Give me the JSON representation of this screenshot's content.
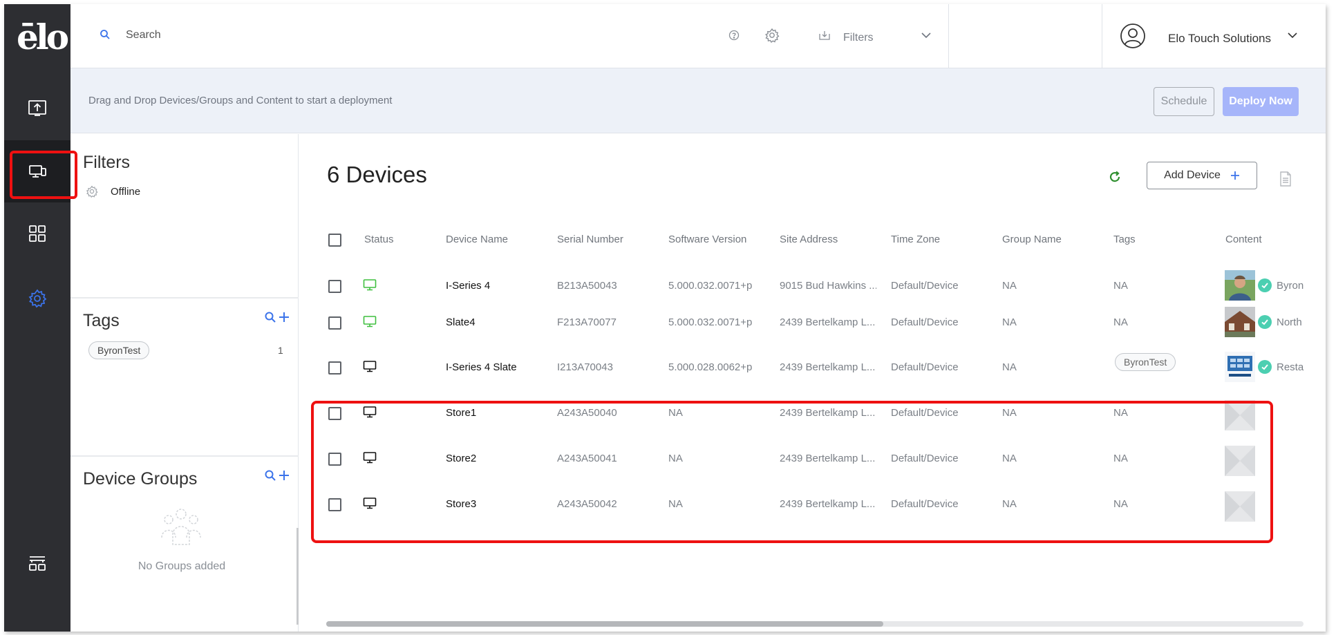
{
  "app": {
    "logo_text": "ēlo"
  },
  "topbar": {
    "search_placeholder": "Search",
    "filters_label": "Filters",
    "user_name": "Elo Touch Solutions"
  },
  "deploy": {
    "message": "Drag and Drop Devices/Groups and Content to start a deployment",
    "schedule_label": "Schedule",
    "deploy_label": "Deploy Now"
  },
  "filters": {
    "title": "Filters",
    "items": [
      {
        "label": "Offline"
      }
    ]
  },
  "tags": {
    "title": "Tags",
    "items": [
      {
        "label": "ByronTest",
        "count": "1"
      }
    ]
  },
  "groups": {
    "title": "Device Groups",
    "empty_text": "No Groups added"
  },
  "devices": {
    "title": "6 Devices",
    "add_label": "Add Device",
    "columns": [
      "Status",
      "Device Name",
      "Serial Number",
      "Software Version",
      "Site Address",
      "Time Zone",
      "Group Name",
      "Tags",
      "Content"
    ],
    "rows": [
      {
        "status": "online",
        "name": "I-Series 4",
        "serial": "B213A50043",
        "version": "5.000.032.0071+p",
        "address": "9015 Bud Hawkins ...",
        "timezone": "Default/Device",
        "group": "NA",
        "tags": "NA",
        "content": "Byron"
      },
      {
        "status": "online",
        "name": "Slate4",
        "serial": "F213A70077",
        "version": "5.000.032.0071+p",
        "address": "2439 Bertelkamp L...",
        "timezone": "Default/Device",
        "group": "NA",
        "tags": "NA",
        "content": "North"
      },
      {
        "status": "offline",
        "name": "I-Series 4 Slate",
        "serial": "I213A70043",
        "version": "5.000.028.0062+p",
        "address": "2439 Bertelkamp L...",
        "timezone": "Default/Device",
        "group": "NA",
        "tags": "ByronTest",
        "content": "Restau"
      },
      {
        "status": "offline",
        "name": "Store1",
        "serial": "A243A50040",
        "version": "NA",
        "address": "2439 Bertelkamp L...",
        "timezone": "Default/Device",
        "group": "NA",
        "tags": "NA",
        "content": ""
      },
      {
        "status": "offline",
        "name": "Store2",
        "serial": "A243A50041",
        "version": "NA",
        "address": "2439 Bertelkamp L...",
        "timezone": "Default/Device",
        "group": "NA",
        "tags": "NA",
        "content": ""
      },
      {
        "status": "offline",
        "name": "Store3",
        "serial": "A243A50042",
        "version": "NA",
        "address": "2439 Bertelkamp L...",
        "timezone": "Default/Device",
        "group": "NA",
        "tags": "NA",
        "content": ""
      }
    ]
  },
  "colors": {
    "rail": "#2d2e32",
    "accent_blue": "#3b73ea",
    "online_green": "#3fbf3f",
    "highlight_red": "#ee1111",
    "deploy_button": "#a6b5fa",
    "refresh_green": "#2f8f2f"
  },
  "icons": [
    "search-icon",
    "help-icon",
    "gear-icon",
    "filter-download-icon",
    "chevron-down-icon",
    "user-avatar-icon",
    "upload-icon",
    "devices-icon",
    "grid-icon",
    "settings-icon",
    "menu-layout-icon",
    "refresh-icon",
    "plus-icon",
    "document-icon",
    "monitor-icon"
  ]
}
